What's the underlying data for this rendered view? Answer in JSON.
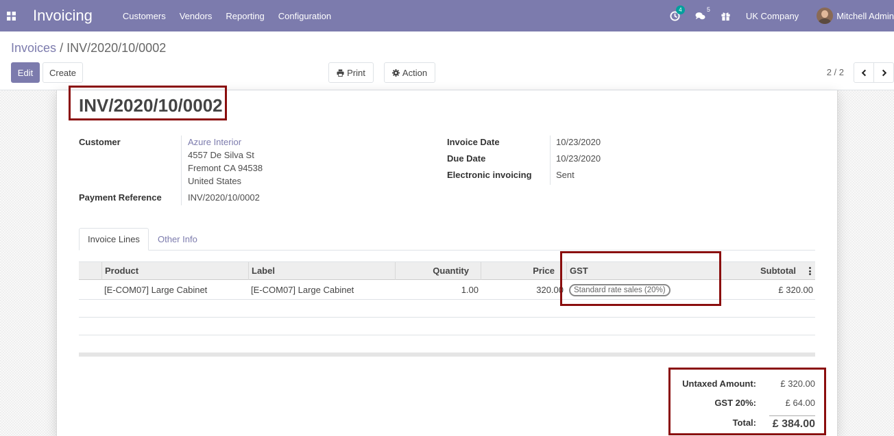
{
  "navbar": {
    "app_title": "Invoicing",
    "menu": [
      "Customers",
      "Vendors",
      "Reporting",
      "Configuration"
    ],
    "activity_count": "4",
    "message_count": "5",
    "company": "UK Company",
    "user": "Mitchell Admin",
    "color": "#7c7bad"
  },
  "breadcrumb": {
    "parent": "Invoices",
    "separator": "/",
    "current": "INV/2020/10/0002"
  },
  "buttons": {
    "edit": "Edit",
    "create": "Create",
    "print": "Print",
    "action": "Action"
  },
  "pager": {
    "value": "2 / 2"
  },
  "invoice": {
    "name": "INV/2020/10/0002",
    "customer_label": "Customer",
    "customer_name": "Azure Interior",
    "address_line1": "4557 De Silva St",
    "address_line2": "Fremont CA 94538",
    "address_line3": "United States",
    "payment_ref_label": "Payment Reference",
    "payment_ref": "INV/2020/10/0002",
    "invoice_date_label": "Invoice Date",
    "invoice_date": "10/23/2020",
    "due_date_label": "Due Date",
    "due_date": "10/23/2020",
    "einvoicing_label": "Electronic invoicing",
    "einvoicing": "Sent"
  },
  "tabs": {
    "lines": "Invoice Lines",
    "other": "Other Info"
  },
  "table": {
    "headers": {
      "product": "Product",
      "label": "Label",
      "quantity": "Quantity",
      "price": "Price",
      "gst": "GST",
      "subtotal": "Subtotal"
    },
    "rows": [
      {
        "product": "[E-COM07] Large Cabinet",
        "label": "[E-COM07] Large Cabinet",
        "quantity": "1.00",
        "price": "320.00",
        "gst": "Standard rate sales (20%)",
        "subtotal": "£ 320.00"
      }
    ]
  },
  "totals": {
    "untaxed_label": "Untaxed Amount:",
    "untaxed": "£ 320.00",
    "gst_label": "GST 20%:",
    "gst": "£ 64.00",
    "total_label": "Total:",
    "total": "£ 384.00"
  },
  "highlight_color": "#8a0d0d"
}
